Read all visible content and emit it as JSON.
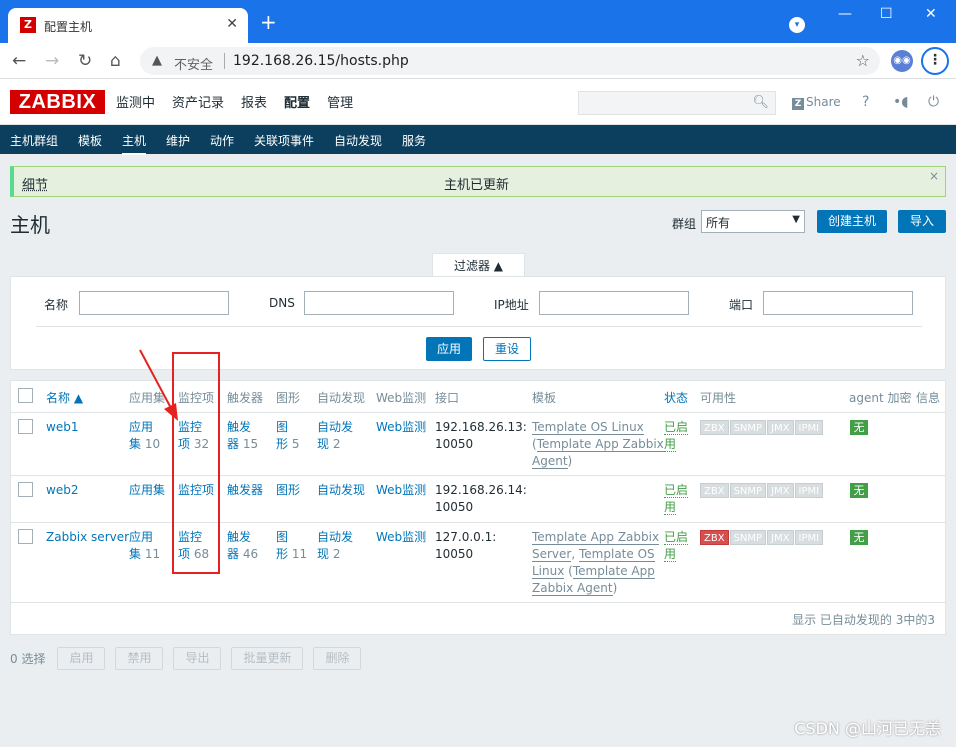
{
  "browser": {
    "tab_title": "配置主机",
    "tab_favicon": "Z",
    "insecure_label": "不安全",
    "url": "192.168.26.15/hosts.php"
  },
  "zabbix": {
    "logo": "ZABBIX",
    "menu": [
      "监测中",
      "资产记录",
      "报表",
      "配置",
      "管理"
    ],
    "active_menu": "配置",
    "search_placeholder": "",
    "share_label": "Share",
    "share_icon": "Z",
    "help_glyph": "?",
    "user_glyph": "•◖",
    "logout_glyph": "⏻",
    "submenu": [
      "主机群组",
      "模板",
      "主机",
      "维护",
      "动作",
      "关联项事件",
      "自动发现",
      "服务"
    ],
    "active_submenu": "主机"
  },
  "message": {
    "details_label": "细节",
    "text": "主机已更新",
    "close_glyph": "×"
  },
  "page": {
    "title": "主机",
    "group_label": "群组",
    "group_value": "所有",
    "create_button": "创建主机",
    "import_button": "导入"
  },
  "filter": {
    "tab_label": "过滤器 ▲",
    "name_label": "名称",
    "dns_label": "DNS",
    "ip_label": "IP地址",
    "port_label": "端口",
    "apply_button": "应用",
    "reset_button": "重设"
  },
  "table": {
    "headers": {
      "name": "名称 ▲",
      "applications": "应用集",
      "items": "监控项",
      "triggers": "触发器",
      "graphs": "图形",
      "discovery": "自动发现",
      "web": "Web监测",
      "interface": "接口",
      "templates": "模板",
      "status": "状态",
      "availability": "可用性",
      "encryption": "agent 加密",
      "info": "信息"
    },
    "rows": [
      {
        "name": "web1",
        "app_a": "应用",
        "app_b": "集",
        "app_count": "10",
        "item_a": "监控",
        "item_b": "项",
        "item_count": "32",
        "trig_a": "触发",
        "trig_b": "器",
        "trig_count": "15",
        "graph_a": "图",
        "graph_b": "形",
        "graph_count": "5",
        "disc_a": "自动发",
        "disc_b": "现",
        "disc_count": "2",
        "web": "Web监测",
        "iface_a": "192.168.26.13:",
        "iface_b": "10050",
        "tmpl_1": "Template OS Linux",
        "tmpl_2a": "Template App Zabbix",
        "tmpl_2b": "Agent",
        "status_a": "已启",
        "status_b": "用",
        "zbx_state": "grey",
        "encryption": "无"
      },
      {
        "name": "web2",
        "app": "应用集",
        "item": "监控项",
        "trig": "触发器",
        "graph": "图形",
        "disc": "自动发现",
        "web": "Web监测",
        "iface_a": "192.168.26.14:",
        "iface_b": "10050",
        "status_a": "已启",
        "status_b": "用",
        "zbx_state": "grey",
        "encryption": "无"
      },
      {
        "name": "Zabbix server",
        "app_a": "应用",
        "app_b": "集",
        "app_count": "11",
        "item_a": "监控",
        "item_b": "项",
        "item_count": "68",
        "trig_a": "触发",
        "trig_b": "器",
        "trig_count": "46",
        "graph_a": "图",
        "graph_b": "形",
        "graph_count": "11",
        "disc_a": "自动发",
        "disc_b": "现",
        "disc_count": "2",
        "web": "Web监测",
        "iface_a": "127.0.0.1:",
        "iface_b": "10050",
        "tmpl_1a": "Template App Zabbix",
        "tmpl_1b": "Server",
        "tmpl_2": "Template OS",
        "tmpl_2b": "Linux",
        "tmpl_3a": "Template App",
        "tmpl_3b": "Zabbix Agent",
        "status_a": "已启",
        "status_b": "用",
        "zbx_state": "red",
        "encryption": "无"
      }
    ],
    "avail_badges": [
      "ZBX",
      "SNMP",
      "JMX",
      "IPMI"
    ],
    "footer": "显示 已自动发现的 3中的3"
  },
  "bottom": {
    "selected": "0 选择",
    "buttons": [
      "启用",
      "禁用",
      "导出",
      "批量更新",
      "删除"
    ]
  },
  "watermark": "CSDN @山河已无恙",
  "colors": {
    "brand_red": "#d40000",
    "link_blue": "#0275b8",
    "submenu_bg": "#0b3f5d",
    "enabled_green": "#429e47",
    "annotation_red": "#e52222"
  }
}
